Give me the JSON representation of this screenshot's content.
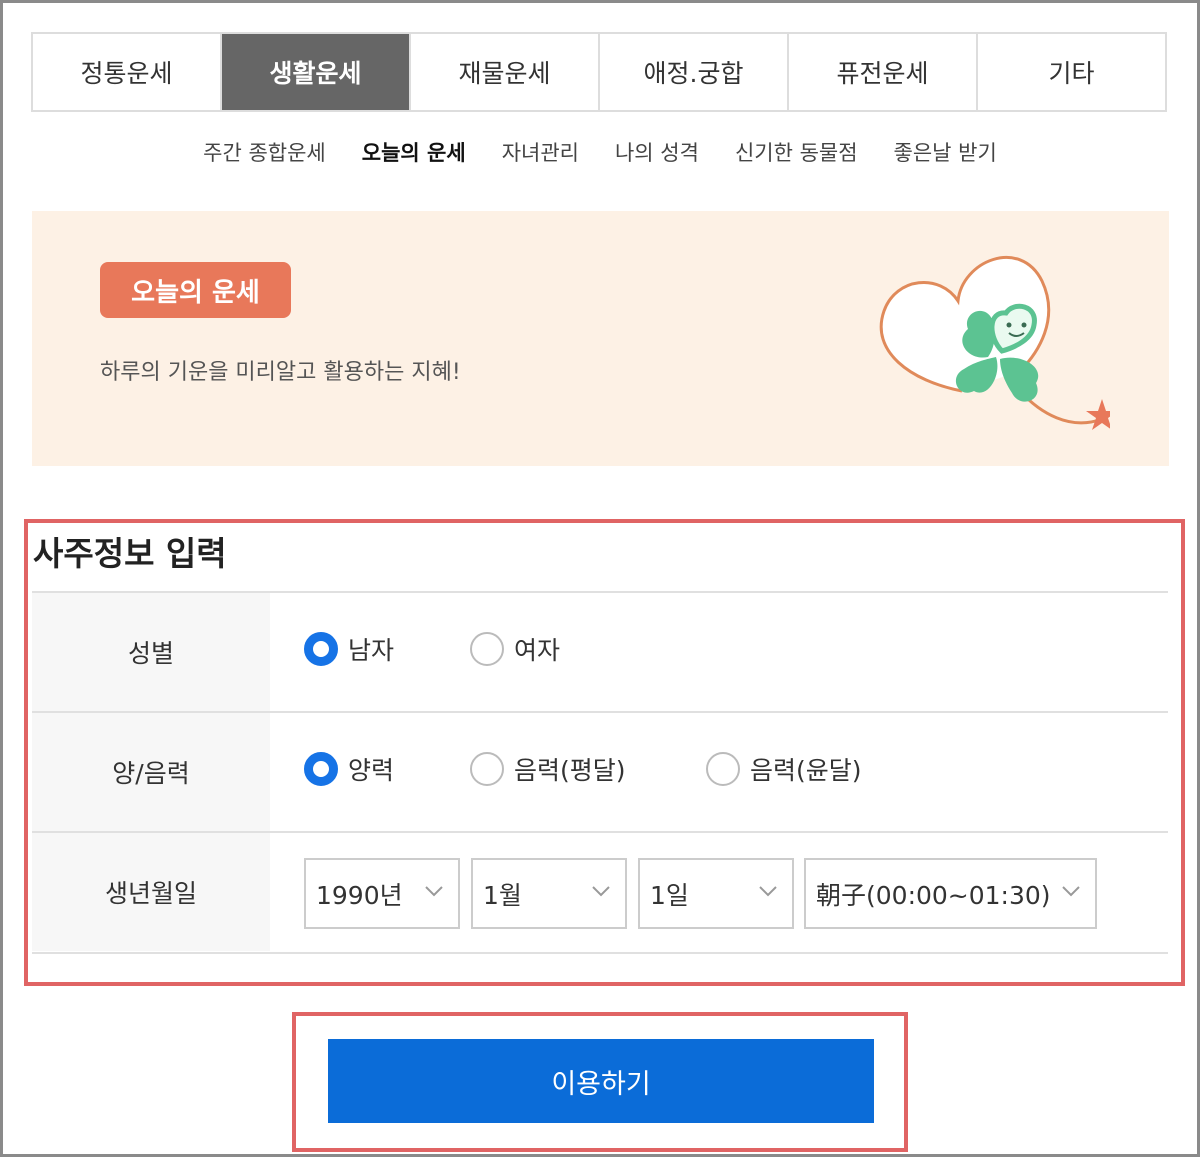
{
  "main_tabs": [
    "정통운세",
    "생활운세",
    "재물운세",
    "애정.궁합",
    "퓨전운세",
    "기타"
  ],
  "main_tab_active": "생활운세",
  "sub_tabs": [
    "주간 종합운세",
    "오늘의 운세",
    "자녀관리",
    "나의 성격",
    "신기한 동물점",
    "좋은날 받기"
  ],
  "sub_tab_active": "오늘의 운세",
  "banner": {
    "badge": "오늘의 운세",
    "description": "하루의 기운을 미리알고 활용하는 지혜!",
    "illustration_icon": "four-leaf-clover-heart-icon"
  },
  "form": {
    "title": "사주정보 입력",
    "gender": {
      "label": "성별",
      "options": [
        "남자",
        "여자"
      ],
      "selected": "남자"
    },
    "calendar": {
      "label": "양/음력",
      "options": [
        "양력",
        "음력(평달)",
        "음력(윤달)"
      ],
      "selected": "양력"
    },
    "birth": {
      "label": "생년월일",
      "year": "1990년",
      "month": "1월",
      "day": "1일",
      "time": "朝子(00:00~01:30)"
    }
  },
  "submit_label": "이용하기",
  "colors": {
    "active_tab_bg": "#666666",
    "badge_bg": "#e8785a",
    "banner_bg": "#fdf1e5",
    "radio_checked": "#1673e6",
    "submit_bg": "#0b6cd8",
    "highlight_outline": "#e06464"
  }
}
